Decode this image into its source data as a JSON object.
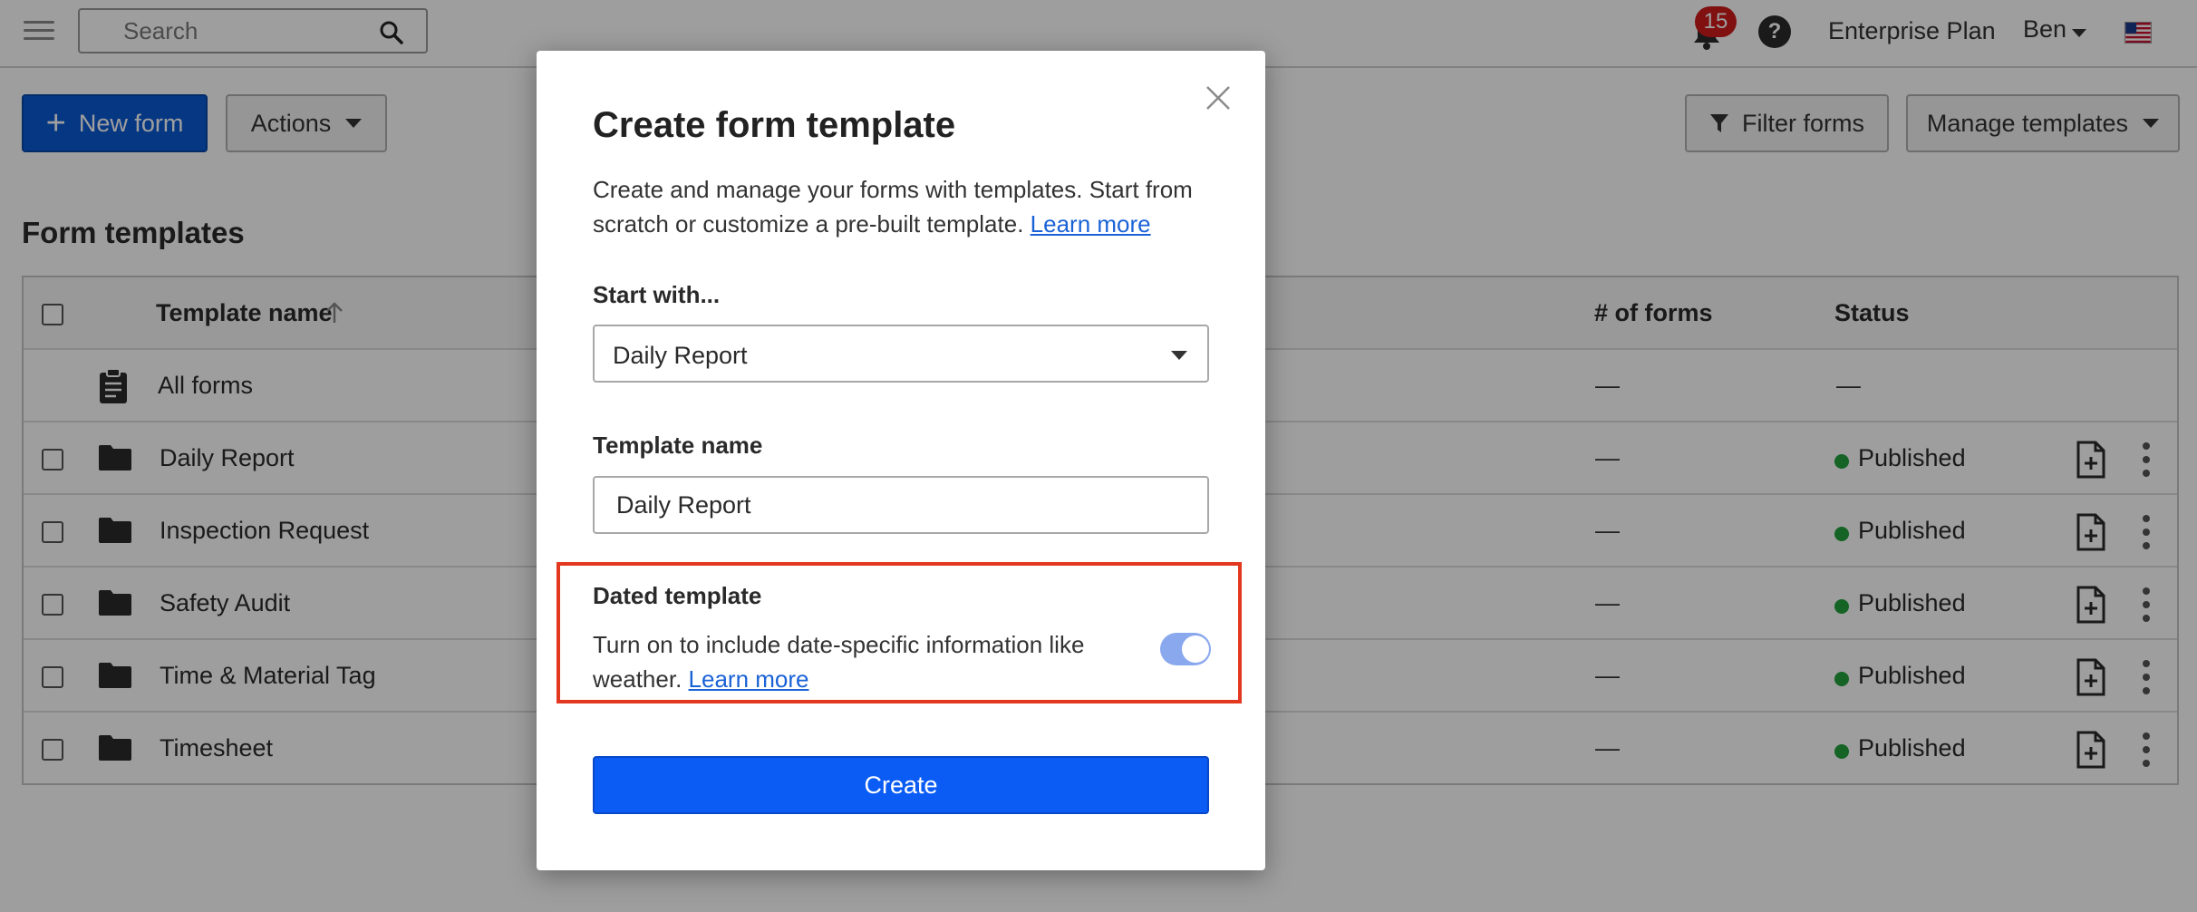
{
  "topbar": {
    "search_placeholder": "Search",
    "notification_count": "15",
    "help_label": "?",
    "plan": "Enterprise Plan",
    "user_name": "Ben"
  },
  "toolbar": {
    "new_form_label": "New form",
    "actions_label": "Actions",
    "filter_label": "Filter forms",
    "manage_templates_label": "Manage templates"
  },
  "section_title": "Form templates",
  "table": {
    "headers": {
      "name": "Template name",
      "forms": "# of forms",
      "status": "Status"
    },
    "all_forms": {
      "name": "All forms",
      "forms": "—",
      "status": "—"
    },
    "rows": [
      {
        "name": "Daily Report",
        "forms": "—",
        "status": "Published"
      },
      {
        "name": "Inspection Request",
        "forms": "—",
        "status": "Published"
      },
      {
        "name": "Safety Audit",
        "forms": "—",
        "status": "Published"
      },
      {
        "name": "Time & Material Tag",
        "forms": "—",
        "status": "Published"
      },
      {
        "name": "Timesheet",
        "forms": "—",
        "status": "Published"
      }
    ]
  },
  "modal": {
    "title": "Create form template",
    "description": "Create and manage your forms with templates. Start from scratch or customize a pre-built template.",
    "learn_more": "Learn more",
    "start_with_label": "Start with...",
    "start_with_value": "Daily Report",
    "template_name_label": "Template name",
    "template_name_value": "Daily Report",
    "dated_template_title": "Dated template",
    "dated_template_desc": "Turn on to include date-specific information like weather.",
    "dated_learn_more": "Learn more",
    "create_label": "Create"
  },
  "colors": {
    "primary": "#0a5ad4",
    "create_button": "#0a5cf5",
    "highlight_border": "#e2381f",
    "status_published": "#23a13d",
    "badge": "#d11a1a",
    "link": "#1a62d6"
  }
}
